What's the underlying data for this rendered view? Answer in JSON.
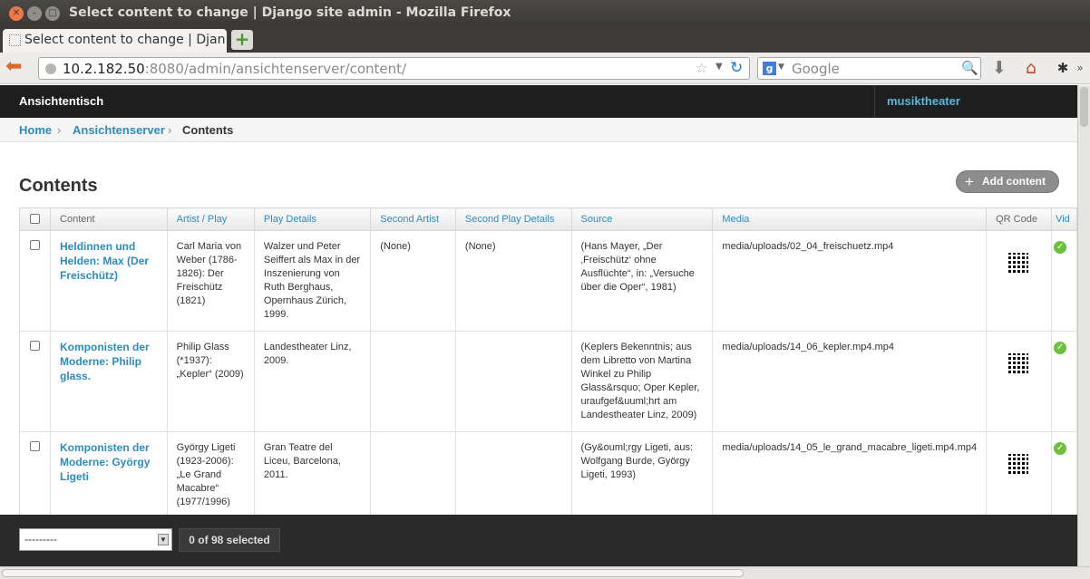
{
  "window": {
    "title": "Select content to change | Django site admin - Mozilla Firefox"
  },
  "browser": {
    "tab_label": "Select content to change | Djan…",
    "new_tab": "+",
    "url_host": "10.2.182.50",
    "url_rest": ":8080/admin/ansichtenserver/content/",
    "search_placeholder": "Google"
  },
  "admin": {
    "brand": "Ansichtentisch",
    "user": "musiktheater",
    "breadcrumbs": [
      "Home",
      "Ansichtenserver",
      "Contents"
    ],
    "title": "Contents",
    "add_button": "Add content"
  },
  "table": {
    "columns": [
      "Content",
      "Artist / Play",
      "Play Details",
      "Second Artist",
      "Second Play Details",
      "Source",
      "Media",
      "QR Code",
      "Vid"
    ],
    "rows": [
      {
        "content": "Heldinnen und Helden: Max (Der Freischütz)",
        "artist": "Carl Maria von Weber (1786-1826): Der Freischütz (1821)",
        "details": "Walzer und Peter Seiffert als Max in der Inszenierung von Ruth Berghaus, Opernhaus Zürich, 1999.",
        "second_artist": "(None)",
        "second_details": "(None)",
        "source": "(Hans Mayer, „Der ‚Freischütz‘ ohne Ausflüchte“, in: „Versuche über die Oper“, 1981)",
        "media": "media/uploads/02_04_freischuetz.mp4"
      },
      {
        "content": "Komponisten der Moderne: Philip glass.",
        "artist": "Philip Glass (*1937): „Kepler“ (2009)",
        "details": "Landestheater Linz, 2009.",
        "second_artist": "",
        "second_details": "",
        "source": "(Keplers Bekenntnis; aus dem Libretto von Martina Winkel zu Philip Glass&rsquo; Oper Kepler, uraufgef&uuml;hrt am Landestheater Linz, 2009)",
        "media": "media/uploads/14_06_kepler.mp4.mp4"
      },
      {
        "content": "Komponisten der Moderne: György Ligeti",
        "artist": "György Ligeti (1923-2006): „Le Grand Macabre“ (1977/1996)",
        "details": "Gran Teatre del Liceu, Barcelona, 2011.",
        "second_artist": "",
        "second_details": "",
        "source": "(Gy&ouml;rgy Ligeti, aus: Wolfgang Burde, György Ligeti, 1993)",
        "media": "media/uploads/14_05_le_grand_macabre_ligeti.mp4.mp4"
      }
    ]
  },
  "actions": {
    "select_value": "---------",
    "counter": "0 of 98 selected"
  }
}
